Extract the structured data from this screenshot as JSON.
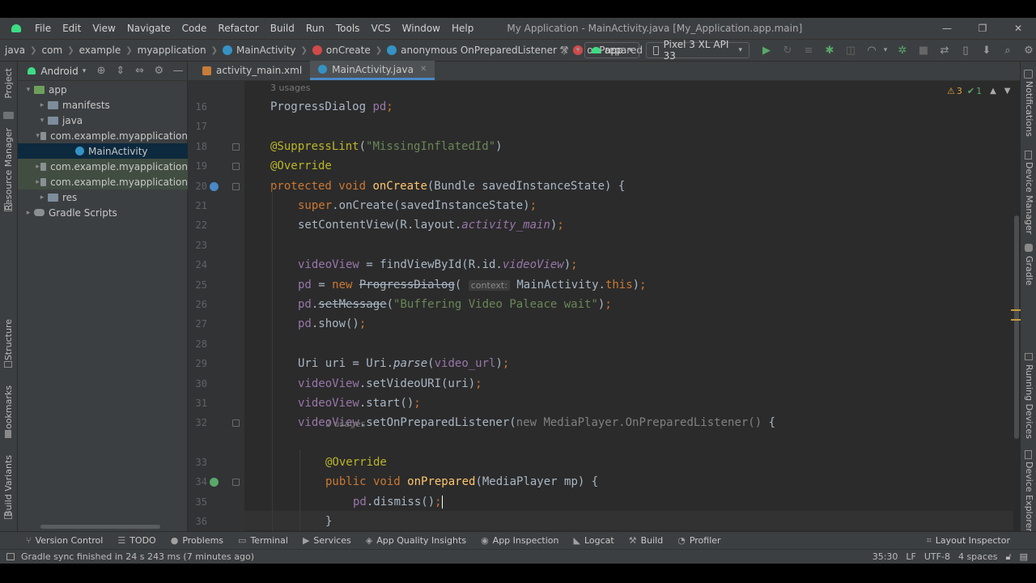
{
  "title_bar": {
    "menu": [
      "File",
      "Edit",
      "View",
      "Navigate",
      "Code",
      "Refactor",
      "Build",
      "Run",
      "Tools",
      "VCS",
      "Window",
      "Help"
    ],
    "window_title": "My Application - MainActivity.java [My_Application.app.main]"
  },
  "nav_bar": {
    "breadcrumbs": [
      "java",
      "com",
      "example",
      "myapplication",
      "MainActivity",
      "onCreate",
      "anonymous OnPreparedListener",
      "onPrepared"
    ],
    "run_config": "app",
    "device": "Pixel 3 XL API 33"
  },
  "left_strip": {
    "labels": [
      "Project",
      "Resource Manager",
      "Structure",
      "Bookmarks",
      "Build Variants"
    ]
  },
  "right_strip": {
    "labels": [
      "Notifications",
      "Device Manager",
      "Gradle",
      "Running Devices",
      "Device Explorer"
    ]
  },
  "project_panel": {
    "view_mode": "Android",
    "tree": [
      {
        "label": "app",
        "depth": 0,
        "arrow": "▾",
        "icon": "module"
      },
      {
        "label": "manifests",
        "depth": 1,
        "arrow": "▸",
        "icon": "folder"
      },
      {
        "label": "java",
        "depth": 1,
        "arrow": "▾",
        "icon": "folder"
      },
      {
        "label": "com.example.myapplication",
        "depth": 2,
        "arrow": "▾",
        "icon": "package"
      },
      {
        "label": "MainActivity",
        "depth": 3,
        "arrow": "",
        "icon": "class",
        "selected": true
      },
      {
        "label": "com.example.myapplication",
        "depth": 2,
        "arrow": "▸",
        "icon": "package",
        "highlight": true
      },
      {
        "label": "com.example.myapplication",
        "depth": 2,
        "arrow": "▸",
        "icon": "package",
        "highlight": true
      },
      {
        "label": "res",
        "depth": 1,
        "arrow": "▸",
        "icon": "folder"
      },
      {
        "label": "Gradle Scripts",
        "depth": 0,
        "arrow": "▸",
        "icon": "gradle"
      }
    ]
  },
  "editor": {
    "tabs": [
      {
        "label": "activity_main.xml",
        "active": false
      },
      {
        "label": "MainActivity.java",
        "active": true
      }
    ],
    "inspections": {
      "warnings": "3",
      "ok": "1"
    },
    "lines": [
      {
        "hint": "3 usages",
        "n": "16",
        "indent": 0,
        "tokens": [
          [
            "ProgressDialog ",
            ""
          ],
          [
            "pd",
            "fld"
          ],
          [
            ";",
            "kw"
          ]
        ]
      },
      {
        "n": "17",
        "indent": 0,
        "tokens": []
      },
      {
        "n": "18",
        "indent": 0,
        "fold": true,
        "tokens": [
          [
            "@SuppressLint",
            "ann"
          ],
          [
            "(",
            ""
          ],
          [
            "\"MissingInflatedId\"",
            "str"
          ],
          [
            ")",
            ""
          ]
        ]
      },
      {
        "n": "19",
        "indent": 0,
        "fold": true,
        "tokens": [
          [
            "@Override",
            "ann"
          ]
        ]
      },
      {
        "n": "20",
        "indent": 0,
        "fold": true,
        "gutter_icon": true,
        "tokens": [
          [
            "protected void ",
            "kw"
          ],
          [
            "onCreate",
            "fn"
          ],
          [
            "(Bundle savedInstanceState) {",
            ""
          ]
        ]
      },
      {
        "n": "21",
        "indent": 1,
        "tokens": [
          [
            "super",
            "kw"
          ],
          [
            ".onCreate(savedInstanceState)",
            ""
          ],
          [
            ";",
            "kw"
          ]
        ]
      },
      {
        "n": "22",
        "indent": 1,
        "tokens": [
          [
            "setContentView(R.layout.",
            ""
          ],
          [
            "activity_main",
            "fld ital"
          ],
          [
            ")",
            ""
          ],
          [
            ";",
            "kw"
          ]
        ]
      },
      {
        "n": "23",
        "indent": 0,
        "tokens": []
      },
      {
        "n": "24",
        "indent": 1,
        "tokens": [
          [
            "videoView",
            "fld"
          ],
          [
            " = findViewById(R.id.",
            ""
          ],
          [
            "videoView",
            "fld ital"
          ],
          [
            ")",
            ""
          ],
          [
            ";",
            "kw"
          ]
        ]
      },
      {
        "n": "25",
        "indent": 1,
        "tokens": [
          [
            "pd",
            "fld"
          ],
          [
            " = ",
            ""
          ],
          [
            "new ",
            "kw"
          ],
          [
            "ProgressDialog",
            "strike"
          ],
          [
            "( ",
            ""
          ],
          [
            "context:",
            "param"
          ],
          [
            " MainActivity.",
            ""
          ],
          [
            "this",
            "kw"
          ],
          [
            ")",
            ""
          ],
          [
            ";",
            "kw"
          ]
        ]
      },
      {
        "n": "26",
        "indent": 1,
        "tokens": [
          [
            "pd",
            "fld"
          ],
          [
            ".",
            ""
          ],
          [
            "setMessage",
            "strike"
          ],
          [
            "(",
            ""
          ],
          [
            "\"Buffering Video Paleace wait\"",
            "str"
          ],
          [
            ")",
            ""
          ],
          [
            ";",
            "kw"
          ]
        ]
      },
      {
        "n": "27",
        "indent": 1,
        "tokens": [
          [
            "pd",
            "fld"
          ],
          [
            ".show()",
            ""
          ],
          [
            ";",
            "kw"
          ]
        ]
      },
      {
        "n": "28",
        "indent": 0,
        "tokens": []
      },
      {
        "n": "29",
        "indent": 1,
        "tokens": [
          [
            "Uri uri = Uri.",
            ""
          ],
          [
            "parse",
            "ital"
          ],
          [
            "(",
            ""
          ],
          [
            "video_url",
            "fld"
          ],
          [
            ")",
            ""
          ],
          [
            ";",
            "kw"
          ]
        ]
      },
      {
        "n": "30",
        "indent": 1,
        "tokens": [
          [
            "videoView",
            "fld"
          ],
          [
            ".setVideoURI(uri)",
            ""
          ],
          [
            ";",
            "kw"
          ]
        ]
      },
      {
        "n": "31",
        "indent": 1,
        "tokens": [
          [
            "videoView",
            "fld"
          ],
          [
            ".start()",
            ""
          ],
          [
            ";",
            "kw"
          ]
        ]
      },
      {
        "n": "32",
        "indent": 1,
        "fold": true,
        "tokens": [
          [
            "videoView",
            "fld"
          ],
          [
            ".setOnPreparedListener(",
            ""
          ],
          [
            "new MediaPlayer.OnPreparedListener() ",
            "dim"
          ],
          [
            "{",
            ""
          ]
        ]
      },
      {
        "hint": "2 usages",
        "n": "33",
        "indent": 2,
        "tokens": [
          [
            "@Override",
            "ann"
          ]
        ]
      },
      {
        "n": "34",
        "indent": 2,
        "fold": true,
        "gutter_icon": true,
        "tokens": [
          [
            "public void ",
            "kw"
          ],
          [
            "onPrepared",
            "fn"
          ],
          [
            "(MediaPlayer mp) {",
            ""
          ]
        ]
      },
      {
        "n": "35",
        "indent": 3,
        "caret": true,
        "tokens": [
          [
            "pd",
            "fld"
          ],
          [
            ".dismiss()",
            ""
          ],
          [
            ";",
            "kw"
          ]
        ]
      },
      {
        "n": "36",
        "indent": 2,
        "tokens": [
          [
            "}",
            ""
          ]
        ]
      }
    ]
  },
  "bottom_tools": {
    "left": [
      {
        "icon": "branch-icon",
        "glyph": "⑂",
        "label": "Version Control"
      },
      {
        "icon": "todo-icon",
        "glyph": "☰",
        "label": "TODO"
      },
      {
        "icon": "problems-icon",
        "glyph": "●",
        "label": "Problems"
      },
      {
        "icon": "terminal-icon",
        "glyph": "▭",
        "label": "Terminal"
      },
      {
        "icon": "services-icon",
        "glyph": "▶",
        "label": "Services"
      },
      {
        "icon": "quality-icon",
        "glyph": "◈",
        "label": "App Quality Insights"
      },
      {
        "icon": "inspection-icon",
        "glyph": "◉",
        "label": "App Inspection"
      },
      {
        "icon": "logcat-icon",
        "glyph": "◣",
        "label": "Logcat"
      },
      {
        "icon": "build-icon",
        "glyph": "⚒",
        "label": "Build"
      },
      {
        "icon": "profiler-icon",
        "glyph": "◔",
        "label": "Profiler"
      }
    ],
    "right": {
      "icon": "layout-inspector-icon",
      "glyph": "⌗",
      "label": "Layout Inspector"
    }
  },
  "status_bar": {
    "message": "Gradle sync finished in 24 s 243 ms (7 minutes ago)",
    "position": "35:30",
    "line_sep": "LF",
    "encoding": "UTF-8",
    "indent": "4 spaces"
  },
  "colors": {
    "accent": "#4a88c7",
    "android_green": "#3ddc84",
    "class_icon": "#3592c4",
    "method_icon": "#d14a4a"
  }
}
